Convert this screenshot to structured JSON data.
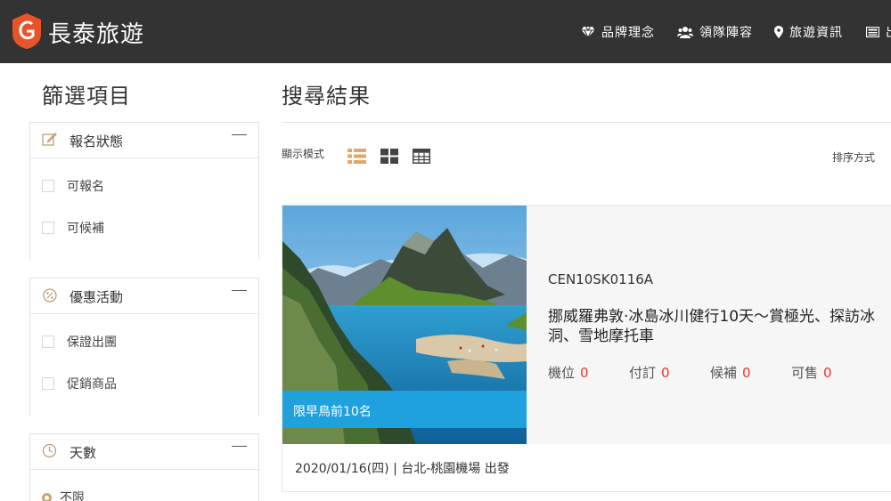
{
  "header": {
    "brand": "長泰旅遊",
    "nav": [
      {
        "label": "品牌理念",
        "icon": "diamond-icon"
      },
      {
        "label": "領隊陣容",
        "icon": "users-icon"
      },
      {
        "label": "旅遊資訊",
        "icon": "map-pin-icon"
      },
      {
        "label": "出",
        "icon": "newspaper-icon"
      }
    ]
  },
  "filters": {
    "title": "篩選項目",
    "groups": [
      {
        "title": "報名狀態",
        "icon": "edit-icon",
        "options": [
          "可報名",
          "可候補"
        ]
      },
      {
        "title": "優惠活動",
        "icon": "discount-icon",
        "options": [
          "保證出團",
          "促銷商品"
        ]
      },
      {
        "title": "天數",
        "icon": "clock-icon",
        "options": [
          "不限"
        ]
      }
    ]
  },
  "results": {
    "title": "搜尋結果",
    "view_label": "顯示模式",
    "sort_label": "排序方式"
  },
  "product": {
    "promo": "限早鳥前10名",
    "code": "CEN10SK0116A",
    "title": "挪威羅弗敦‧冰島冰川健行10天～賞極光、探訪冰洞、雪地摩托車",
    "stats": [
      {
        "label": "機位",
        "value": "0"
      },
      {
        "label": "付訂",
        "value": "0"
      },
      {
        "label": "候補",
        "value": "0"
      },
      {
        "label": "可售",
        "value": "0"
      }
    ],
    "departure": "2020/01/16(四) | 台北-桃園機場 出發"
  },
  "colors": {
    "header_bg": "#333333",
    "accent_gold": "#c6a77a",
    "promo_blue": "#1ea1dc",
    "stat_red": "#e8372c",
    "logo_orange": "#e8532b"
  }
}
